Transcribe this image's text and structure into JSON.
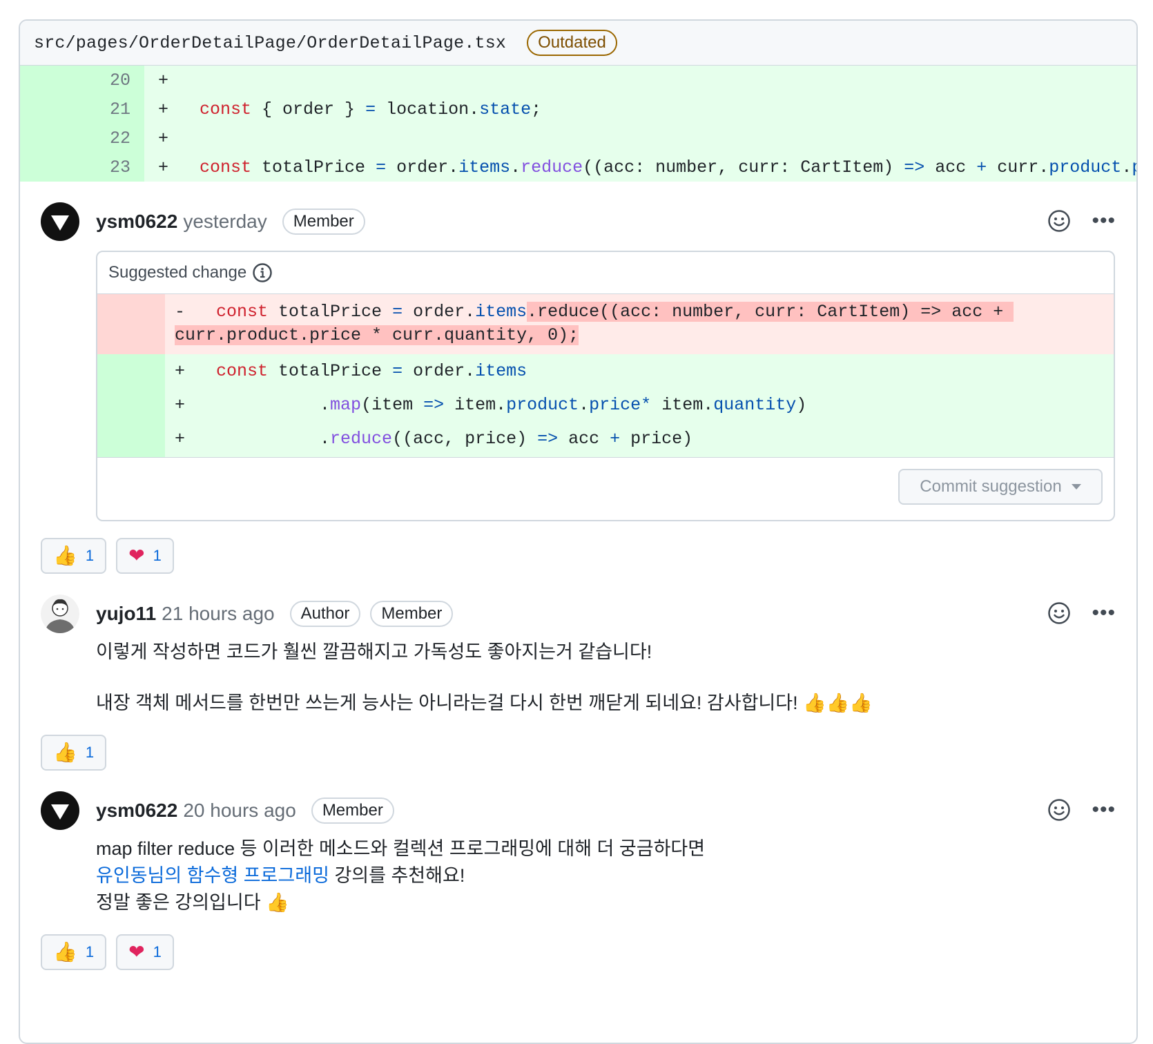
{
  "file": {
    "path": "src/pages/OrderDetailPage/OrderDetailPage.tsx",
    "badge": "Outdated"
  },
  "diff_lines": [
    {
      "num": "20",
      "code": "+"
    },
    {
      "num": "21",
      "code": "+   const { order } = location.state;"
    },
    {
      "num": "22",
      "code": "+"
    },
    {
      "num": "23",
      "code": "+   const totalPrice = order.items.reduce((acc: number, curr: CartItem) => acc + curr.product.pr"
    }
  ],
  "comments": [
    {
      "author": "ysm0622",
      "time": "yesterday",
      "badges": [
        "Member"
      ],
      "suggestion": {
        "title": "Suggested change",
        "removed_line1": "-   const totalPrice = order.items.reduce((acc: number, curr: CartItem) => acc +",
        "removed_line2": "curr.product.price * curr.quantity, 0);",
        "added": [
          "+   const totalPrice = order.items",
          "+             .map(item => item.product.price * item.quantity)",
          "+             .reduce((acc, price) => acc + price)"
        ],
        "commit_label": "Commit suggestion"
      },
      "reactions": [
        {
          "emoji": "👍",
          "count": "1"
        },
        {
          "emoji": "❤",
          "count": "1"
        }
      ]
    },
    {
      "author": "yujo11",
      "time": "21 hours ago",
      "badges": [
        "Author",
        "Member"
      ],
      "body_line1": "이렇게 작성하면 코드가 훨씬 깔끔해지고 가독성도 좋아지는거 같습니다!",
      "body_line2": "내장 객체 메서드를 한번만 쓰는게 능사는 아니라는걸 다시 한번 깨닫게 되네요! 감사합니다! 👍👍👍",
      "reactions": [
        {
          "emoji": "👍",
          "count": "1"
        }
      ]
    },
    {
      "author": "ysm0622",
      "time": "20 hours ago",
      "badges": [
        "Member"
      ],
      "body_line1": "map filter reduce 등 이러한 메소드와 컬렉션 프로그래밍에 대해 더 궁금하다면",
      "body_link": "유인동님의 함수형 프로그래밍",
      "body_line2_rest": " 강의를 추천해요!",
      "body_line3": "정말 좋은 강의입니다 👍",
      "reactions": [
        {
          "emoji": "👍",
          "count": "1"
        },
        {
          "emoji": "❤",
          "count": "1"
        }
      ]
    }
  ],
  "colors": {
    "added_bg": "#e6ffec",
    "removed_bg": "#ffebe9",
    "link": "#0969da",
    "outdated": "#9a6700"
  }
}
